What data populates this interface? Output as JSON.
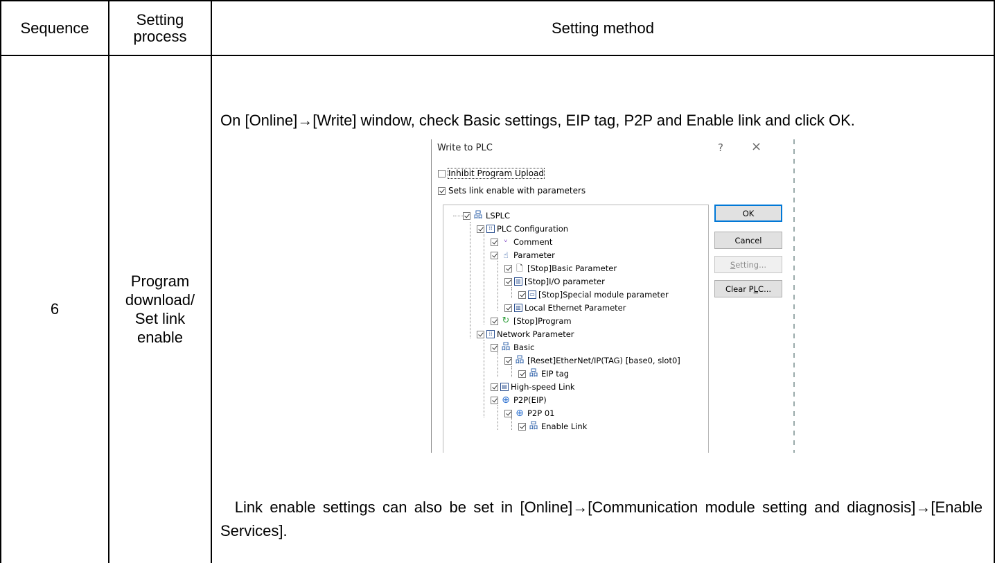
{
  "table": {
    "headers": [
      "Sequence",
      "Setting\nprocess",
      "Setting method"
    ],
    "row": {
      "sequence": "6",
      "process": "Program\ndownload/\nSet link\nenable",
      "instruction": "On [Online]→[Write] window, check Basic settings, EIP tag, P2P and Enable link and click OK.",
      "note": "Link enable settings can also be set in [Online]→[Communication module setting and diagnosis]→[Enable Services]."
    }
  },
  "dialog": {
    "title": "Write to PLC",
    "help_glyph": "?",
    "close_glyph": "×",
    "options": [
      {
        "label": "Inhibit Program Upload",
        "checked": false
      },
      {
        "label": "Sets link enable with parameters",
        "checked": true
      }
    ],
    "tree": [
      {
        "label": "LSPLC",
        "icon": "network-icon",
        "checked": true
      },
      {
        "label": "PLC Configuration",
        "icon": "config-icon",
        "checked": true
      },
      {
        "label": "Comment",
        "icon": "comment-icon",
        "checked": true
      },
      {
        "label": "Parameter",
        "icon": "parameter-icon",
        "checked": true
      },
      {
        "label": "[Stop]Basic Parameter",
        "icon": "document-icon",
        "checked": true
      },
      {
        "label": "[Stop]I/O parameter",
        "icon": "io-icon",
        "checked": true
      },
      {
        "label": "[Stop]Special module parameter",
        "icon": "module-icon",
        "checked": true
      },
      {
        "label": "Local Ethernet Parameter",
        "icon": "io-icon",
        "checked": true
      },
      {
        "label": "[Stop]Program",
        "icon": "program-icon",
        "checked": true
      },
      {
        "label": "Network Parameter",
        "icon": "config-icon",
        "checked": true
      },
      {
        "label": "Basic",
        "icon": "network-icon",
        "checked": true
      },
      {
        "label": "[Reset]EtherNet/IP(TAG) [base0, slot0]",
        "icon": "network-icon",
        "checked": true
      },
      {
        "label": "EIP tag",
        "icon": "network-icon",
        "checked": true
      },
      {
        "label": "High-speed Link",
        "icon": "hs-link-icon",
        "checked": true
      },
      {
        "label": "P2P(EIP)",
        "icon": "globe-icon",
        "checked": true
      },
      {
        "label": "P2P 01",
        "icon": "globe-icon",
        "checked": true
      },
      {
        "label": "Enable Link",
        "icon": "network-icon",
        "checked": true
      }
    ],
    "buttons": {
      "ok": "OK",
      "cancel": "Cancel",
      "setting_pre": "",
      "setting_mn": "S",
      "setting_post": "etting...",
      "clear_pre": "Clear P",
      "clear_mn": "L",
      "clear_post": "C..."
    }
  }
}
